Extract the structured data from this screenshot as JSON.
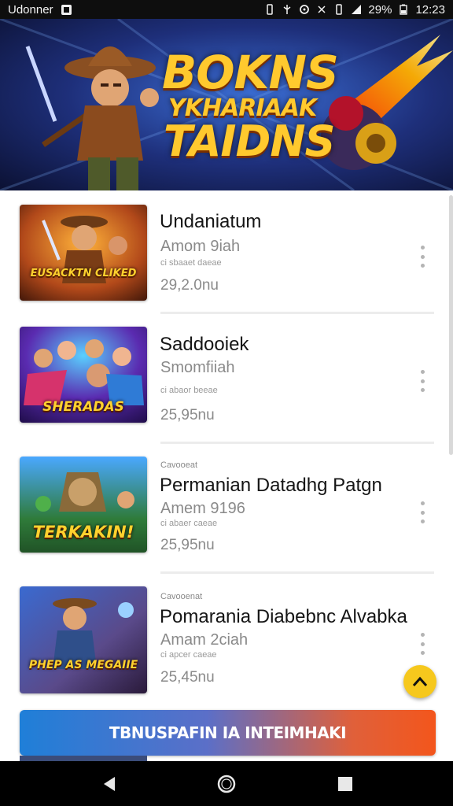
{
  "status_bar": {
    "app_label": "Udonner",
    "battery": "29%",
    "time": "12:23"
  },
  "banner": {
    "title_line1": "BOKNS",
    "title_line2": "YKHARIAAK",
    "title_line3": "TAIDNS"
  },
  "items": [
    {
      "thumb_caption": "EUSACKTN CLIKED",
      "category": "",
      "title": "Undaniatum",
      "subtitle": "Amom 9iah",
      "meta": "ci sbaaet daeae",
      "size": "29,2.0nu"
    },
    {
      "thumb_caption": "SHERADAS",
      "category": "",
      "title": "Saddooiek",
      "subtitle": "Smomfiiah",
      "meta": "ci abaor beeae",
      "size": "25,95nu"
    },
    {
      "thumb_caption": "TERKAKIN!",
      "category": "Cavooeat",
      "title": "Permanian Datadhg Patgn",
      "subtitle": "Amem 9196",
      "meta": "ci abaer caeae",
      "size": "25,95nu"
    },
    {
      "thumb_caption": "PHEP AS MEGAIIE",
      "category": "Cavooenat",
      "title": "Pomarania Diabebnc Alvabka",
      "subtitle": "Amam 2ciah",
      "meta": "ci apcer caeae",
      "size": "25,45nu"
    }
  ],
  "cta_label": "TBNUSPAFIN IA INTEIMHAKI",
  "colors": {
    "cta_start": "#1f7fd8",
    "cta_end": "#f3561c",
    "fab": "#f6c81d",
    "banner_title": "#ffc92e"
  },
  "icons": {
    "status_left": [
      "app-icon"
    ],
    "status_right": [
      "notification-icon",
      "usb-icon",
      "sync-icon",
      "vibrate-icon",
      "sim-icon",
      "signal-icon",
      "battery-icon"
    ],
    "fab": "chevron-up-icon",
    "nav": [
      "back-icon",
      "home-icon",
      "recents-icon"
    ],
    "more": "more-vert-icon"
  }
}
